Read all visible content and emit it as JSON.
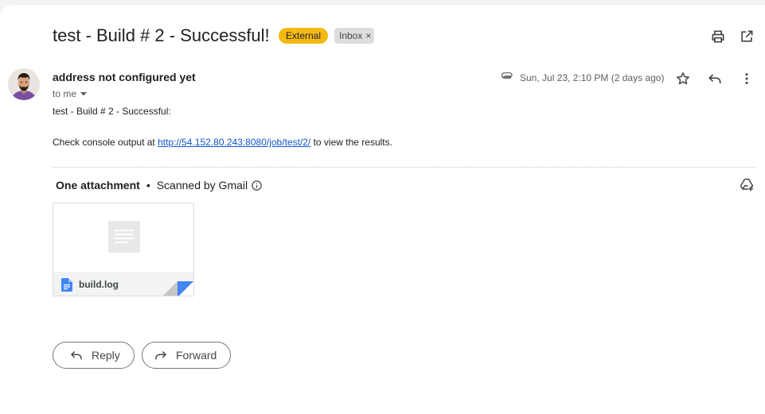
{
  "email": {
    "subject": "test - Build # 2 - Successful!",
    "labels": {
      "external": "External",
      "inbox": "Inbox",
      "inbox_remove": "×"
    },
    "sender": "address not configured yet",
    "recipient": "to me",
    "date": "Sun, Jul 23, 2:10 PM (2 days ago)",
    "body": {
      "line1": "test - Build # 2 - Successful:",
      "line2_prefix": "Check console output at ",
      "link": "http://54.152.80.243:8080/job/test/2/",
      "line2_suffix": " to view the results."
    }
  },
  "attachments": {
    "title": "One attachment",
    "separator": "•",
    "scan_note": "Scanned by Gmail",
    "files": [
      {
        "name": "build.log"
      }
    ]
  },
  "actions": {
    "reply": "Reply",
    "forward": "Forward"
  },
  "icons": {
    "print": "print-icon",
    "open_new_window": "open-in-new-window-icon",
    "attachment_clip": "paperclip-icon",
    "star": "star-icon",
    "reply": "reply-icon",
    "more": "more-vert-icon",
    "add_to_drive": "add-to-drive-icon",
    "info": "info-icon",
    "file": "google-docs-icon"
  },
  "colors": {
    "external_tag": "#f5b914",
    "inbox_tag": "#dddddd",
    "link": "#1155cc",
    "file_icon": "#4285f4"
  }
}
